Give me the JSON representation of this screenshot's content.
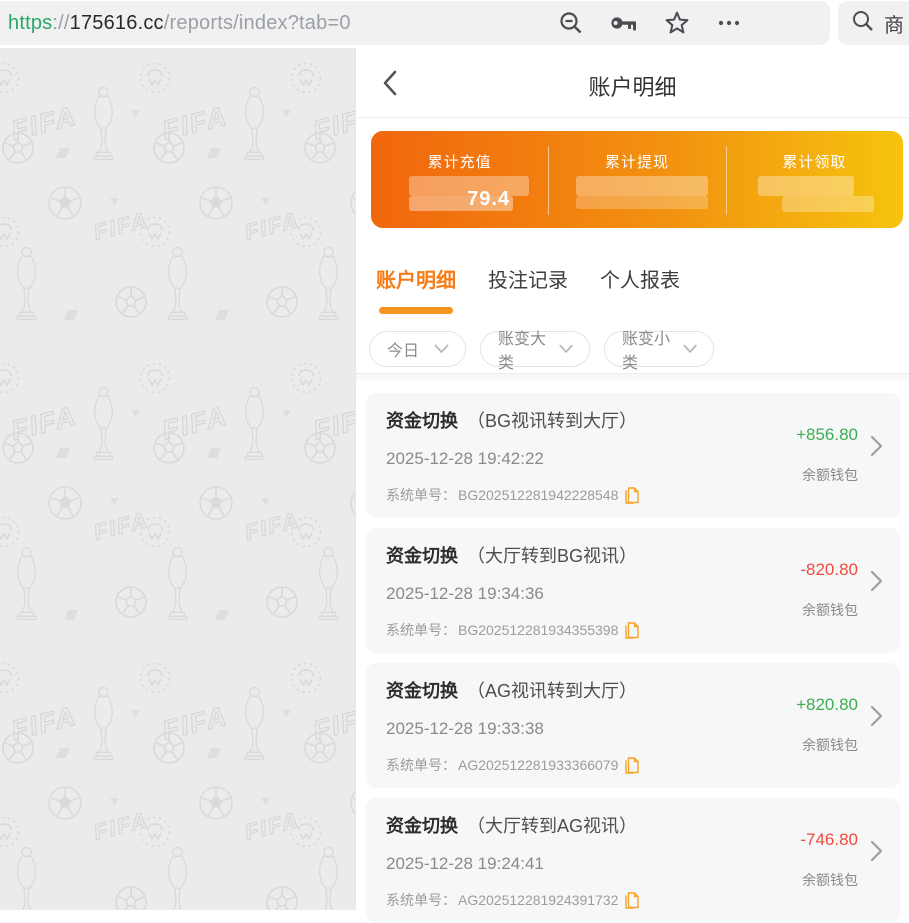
{
  "browser": {
    "url": {
      "protocol": "https",
      "separator": "://",
      "domain": "175616.cc",
      "path": "/reports/index?tab=0"
    },
    "icons": [
      "zoom-out",
      "key",
      "star",
      "more"
    ],
    "side_search": {
      "text": "商"
    }
  },
  "header": {
    "title": "账户明细"
  },
  "summary": {
    "items": [
      {
        "label": "累计充值",
        "masked_value": "79.4"
      },
      {
        "label": "累计提现",
        "masked_value": ""
      },
      {
        "label": "累计领取",
        "masked_value": ""
      }
    ]
  },
  "tabs": {
    "items": [
      {
        "label": "账户明细",
        "active": true
      },
      {
        "label": "投注记录",
        "active": false
      },
      {
        "label": "个人报表",
        "active": false
      }
    ]
  },
  "filters": {
    "items": [
      "今日",
      "账变大类",
      "账变小类"
    ]
  },
  "records_meta": {
    "order_label": "系统单号："
  },
  "records": [
    {
      "type": "资金切换",
      "desc": "（BG视讯转到大厅）",
      "time": "2025-12-28 19:42:22",
      "order_no": "BG202512281942228548",
      "amount": "+856.80",
      "wallet": "余额钱包"
    },
    {
      "type": "资金切换",
      "desc": "（大厅转到BG视讯）",
      "time": "2025-12-28 19:34:36",
      "order_no": "BG202512281934355398",
      "amount": "-820.80",
      "wallet": "余额钱包"
    },
    {
      "type": "资金切换",
      "desc": "（AG视讯转到大厅）",
      "time": "2025-12-28 19:33:38",
      "order_no": "AG202512281933366079",
      "amount": "+820.80",
      "wallet": "余额钱包"
    },
    {
      "type": "资金切换",
      "desc": "（大厅转到AG视讯）",
      "time": "2025-12-28 19:24:41",
      "order_no": "AG202512281924391732",
      "amount": "-746.80",
      "wallet": "余额钱包"
    }
  ],
  "colors": {
    "accent_orange": "#f7941e",
    "gradient_start": "#f1660d",
    "gradient_end": "#f6c30e",
    "positive": "#3cae50",
    "negative": "#f04a3a",
    "copy_icon": "#f5a226",
    "url_protocol_green": "#29a767",
    "pattern_bg": "#ebebeb",
    "pattern_stroke": "#d9d9d9"
  }
}
